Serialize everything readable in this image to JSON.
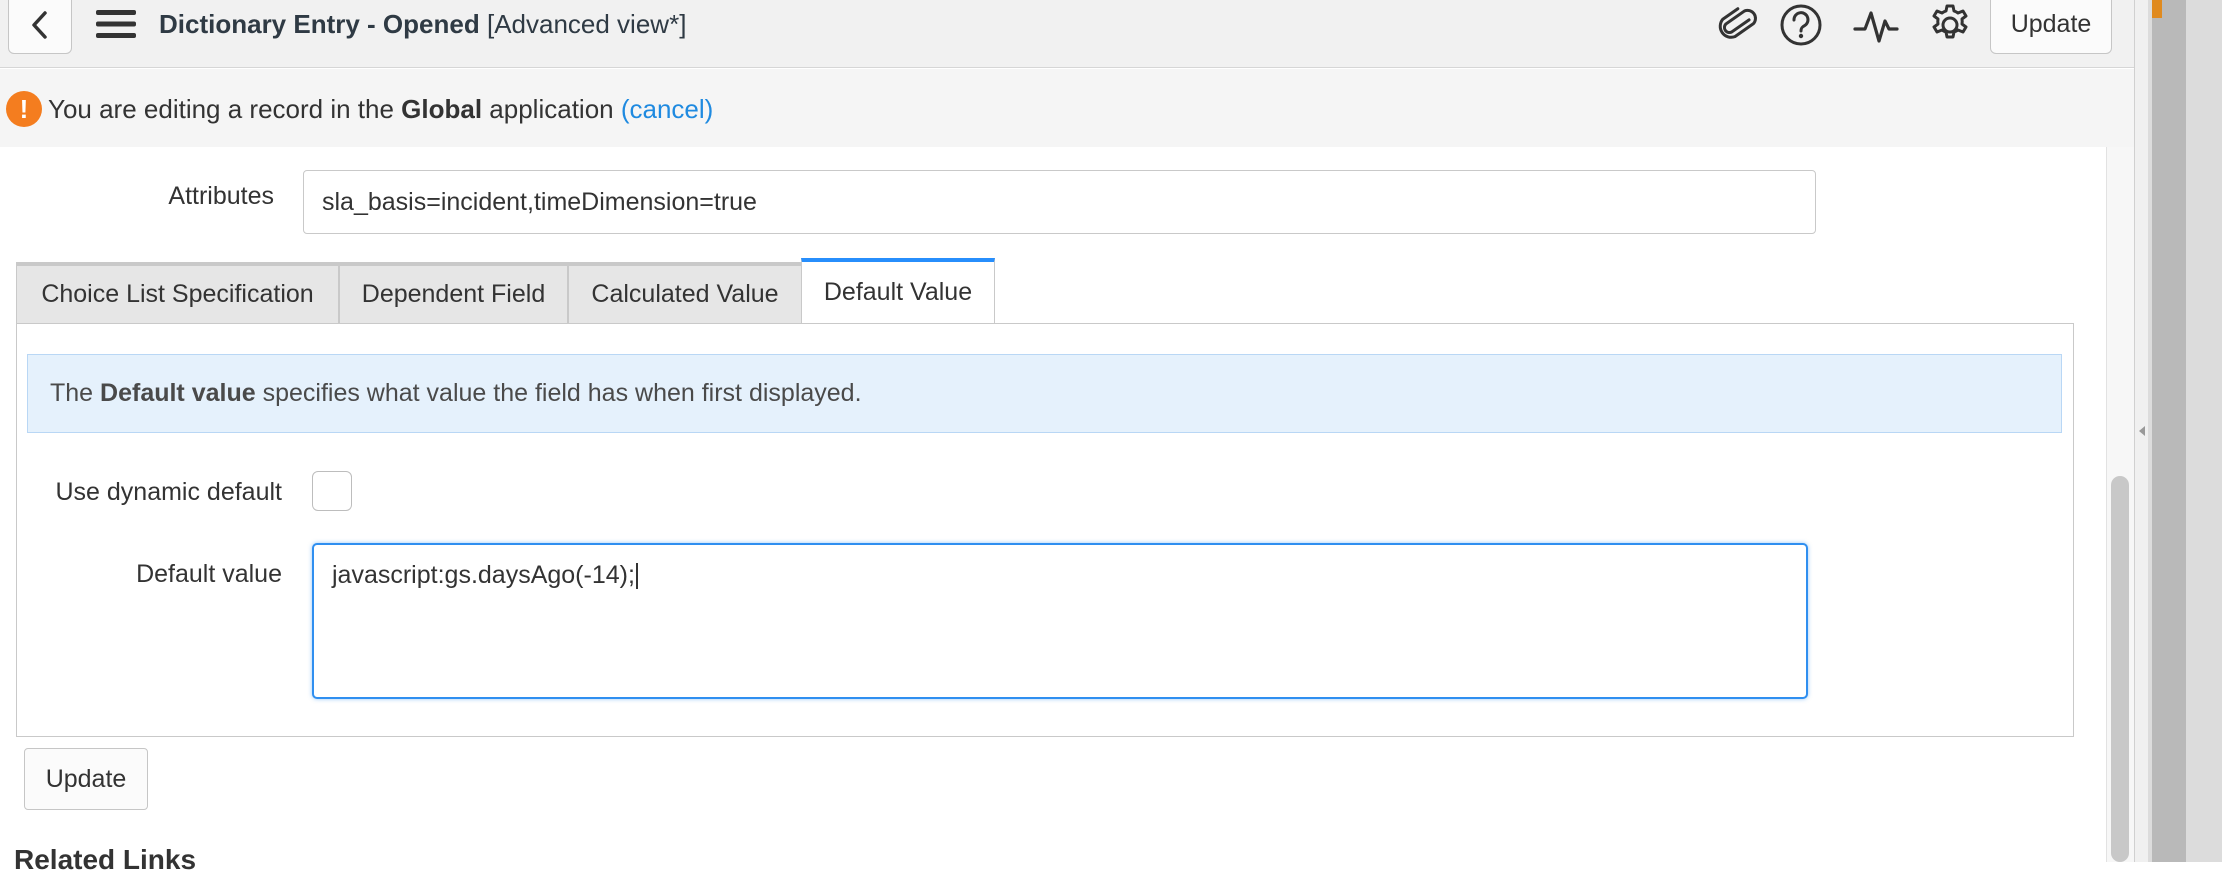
{
  "header": {
    "title_bold": "Dictionary Entry - Opened",
    "title_rest": "[Advanced view*]",
    "update_label": "Update",
    "icons": [
      "chevron-left-icon",
      "hamburger-menu-icon",
      "paperclip-icon",
      "help-icon",
      "activity-icon",
      "gear-icon"
    ]
  },
  "notice": {
    "icon_glyph": "!",
    "text_before": "You are editing a record in the ",
    "app_name": "Global",
    "text_after": " application ",
    "cancel_label": "(cancel)"
  },
  "attributes": {
    "label": "Attributes",
    "value": "sla_basis=incident,timeDimension=true"
  },
  "tabs": [
    {
      "label": "Choice List Specification",
      "active": false
    },
    {
      "label": "Dependent Field",
      "active": false
    },
    {
      "label": "Calculated Value",
      "active": false
    },
    {
      "label": "Default Value",
      "active": true
    }
  ],
  "default_tab": {
    "info_before": "The ",
    "info_bold": "Default value",
    "info_after": " specifies what value the field has when first displayed.",
    "dynamic_label": "Use dynamic default",
    "dynamic_checked": false,
    "default_label": "Default value",
    "default_value": "javascript:gs.daysAgo(-14);"
  },
  "footer": {
    "update_label": "Update",
    "related_links": "Related Links"
  },
  "colors": {
    "accent_blue": "#278efc",
    "link_blue": "#1f8ae0",
    "warning_orange": "#f47d1f",
    "info_bg": "#e5f1fc"
  }
}
